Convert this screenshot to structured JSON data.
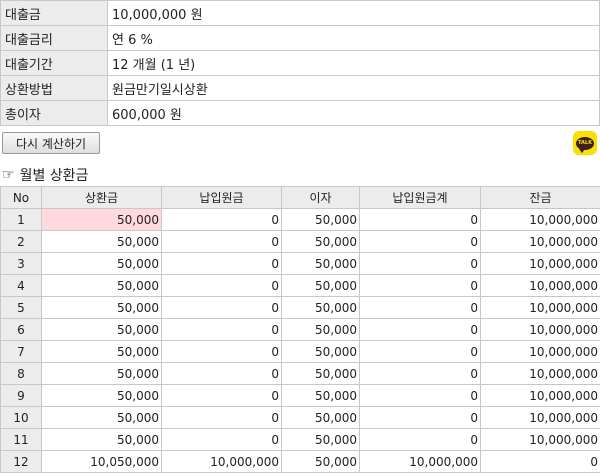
{
  "summary": {
    "rows": [
      {
        "label": "대출금",
        "value": "10,000,000 원"
      },
      {
        "label": "대출금리",
        "value": "연 6 %"
      },
      {
        "label": "대출기간",
        "value": "12 개월 (1 년)"
      },
      {
        "label": "상환방법",
        "value": "원금만기일시상환"
      },
      {
        "label": "총이자",
        "value": "600,000 원"
      }
    ]
  },
  "actions": {
    "recalc_label": "다시 계산하기",
    "kakao_text": "TALK",
    "kakao_icon": "kakaotalk-share-icon",
    "kakao_color": "#f9e000"
  },
  "schedule": {
    "title_icon": "pointing-hand-icon",
    "title": "월별 상환금",
    "highlight_color": "#ffd9dd",
    "columns": [
      "No",
      "상환금",
      "납입원금",
      "이자",
      "납입원금계",
      "잔금"
    ],
    "rows": [
      [
        "1",
        "50,000",
        "0",
        "50,000",
        "0",
        "10,000,000"
      ],
      [
        "2",
        "50,000",
        "0",
        "50,000",
        "0",
        "10,000,000"
      ],
      [
        "3",
        "50,000",
        "0",
        "50,000",
        "0",
        "10,000,000"
      ],
      [
        "4",
        "50,000",
        "0",
        "50,000",
        "0",
        "10,000,000"
      ],
      [
        "5",
        "50,000",
        "0",
        "50,000",
        "0",
        "10,000,000"
      ],
      [
        "6",
        "50,000",
        "0",
        "50,000",
        "0",
        "10,000,000"
      ],
      [
        "7",
        "50,000",
        "0",
        "50,000",
        "0",
        "10,000,000"
      ],
      [
        "8",
        "50,000",
        "0",
        "50,000",
        "0",
        "10,000,000"
      ],
      [
        "9",
        "50,000",
        "0",
        "50,000",
        "0",
        "10,000,000"
      ],
      [
        "10",
        "50,000",
        "0",
        "50,000",
        "0",
        "10,000,000"
      ],
      [
        "11",
        "50,000",
        "0",
        "50,000",
        "0",
        "10,000,000"
      ],
      [
        "12",
        "10,050,000",
        "10,000,000",
        "50,000",
        "10,000,000",
        "0"
      ]
    ]
  }
}
